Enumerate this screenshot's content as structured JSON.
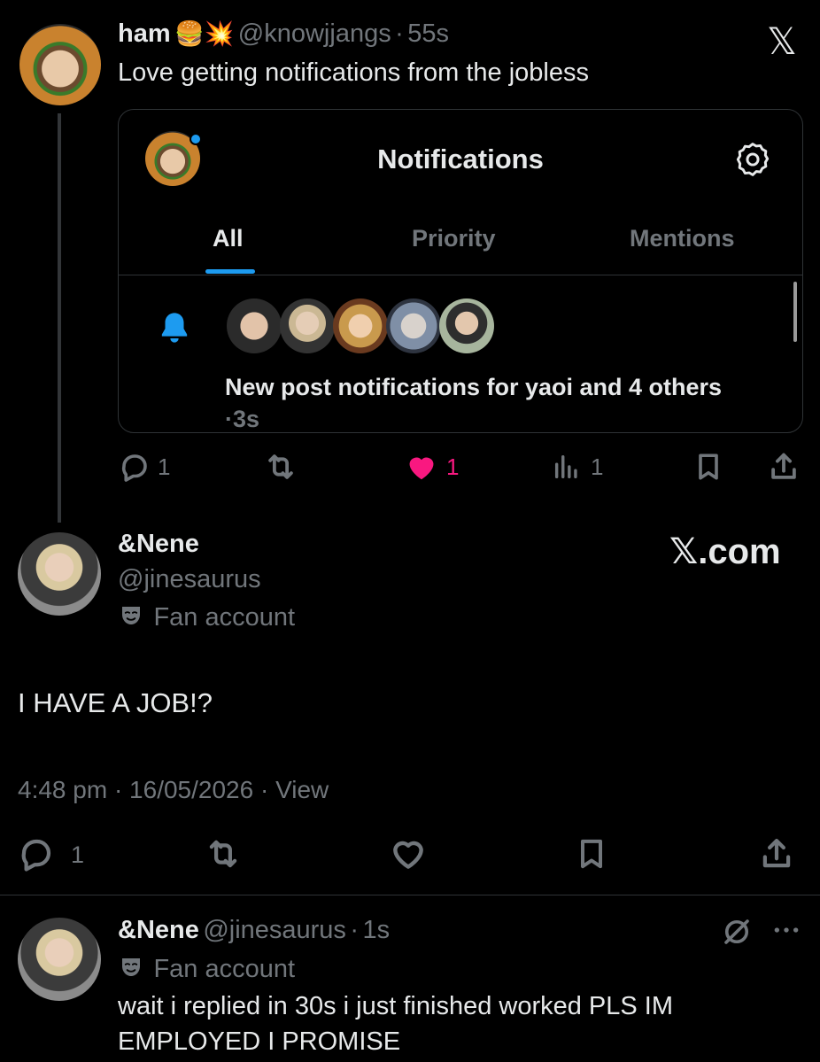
{
  "tweet1": {
    "display_name": "ham",
    "emojis": "🍔💥",
    "handle": "@knowjjangs",
    "sep": "·",
    "time": "55s",
    "text": "Love getting notifications from the jobless",
    "card": {
      "title": "Notifications",
      "tabs": [
        "All",
        "Priority",
        "Mentions"
      ],
      "notification_text": "New post notifications for yaoi and 4 others",
      "notification_time": "·3s"
    },
    "actions": {
      "replies": "1",
      "likes": "1",
      "views": "1"
    }
  },
  "tweet2": {
    "display_name": "&Nene",
    "handle": "@jinesaurus",
    "label": "Fan account",
    "text": "I HAVE A JOB!?",
    "timestamp": "4:48 pm · 16/05/2026 · ",
    "view_link": "View",
    "actions": {
      "replies": "1"
    }
  },
  "tweet3": {
    "display_name": "&Nene",
    "handle": "@jinesaurus",
    "sep": "·",
    "time": "1s",
    "label": "Fan account",
    "text_line1": "wait i replied in 30s i just finished worked PLS IM",
    "text_line2": "EMPLOYED I PROMISE"
  },
  "watermark": "𝕏.com",
  "top_logo": "𝕏",
  "colors": {
    "like": "#f91880",
    "accent": "#1d9bf0",
    "muted": "#71767b"
  }
}
